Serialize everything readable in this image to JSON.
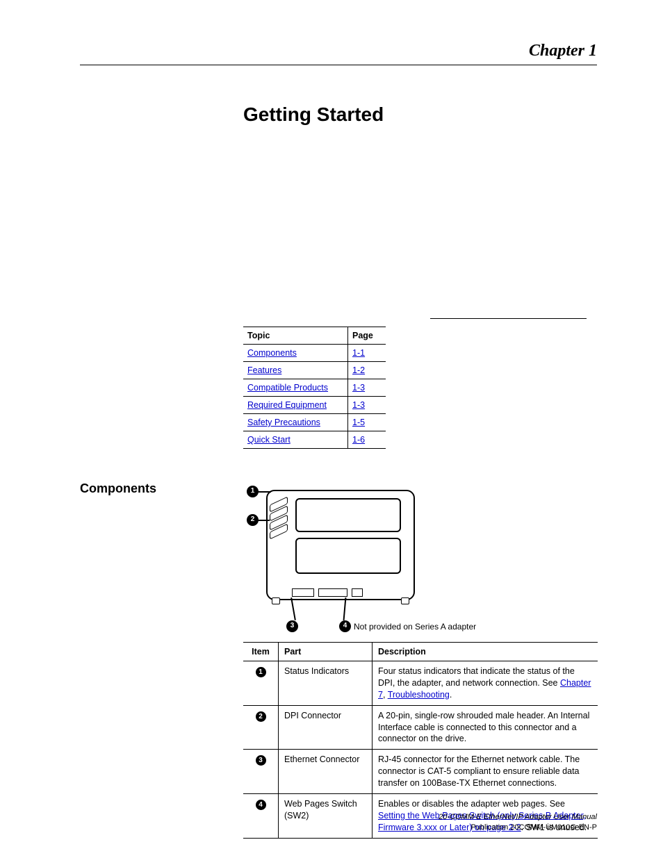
{
  "header": {
    "chapter": "Chapter 1"
  },
  "title": "Getting Started",
  "topicTable": {
    "headers": {
      "topic": "Topic",
      "page": "Page"
    },
    "rows": [
      {
        "topic": "Components",
        "page": "1-1"
      },
      {
        "topic": "Features",
        "page": "1-2"
      },
      {
        "topic": "Compatible Products",
        "page": "1-3"
      },
      {
        "topic": "Required Equipment",
        "page": "1-3"
      },
      {
        "topic": "Safety Precautions",
        "page": "1-5"
      },
      {
        "topic": "Quick Start",
        "page": "1-6"
      }
    ]
  },
  "sectionLabel": "Components",
  "diagram": {
    "callouts": {
      "c1": "1",
      "c2": "2",
      "c3": "3",
      "c4": "4"
    },
    "note": "Not provided on Series A adapter"
  },
  "partsTable": {
    "headers": {
      "item": "Item",
      "part": "Part",
      "description": "Description"
    },
    "rows": [
      {
        "num": "1",
        "part": "Status Indicators",
        "descPre": "Four status indicators that indicate the status of the DPI, the adapter, and network connection. See ",
        "link1": "Chapter 7",
        "mid": ", ",
        "link2": "Troubleshooting",
        "descPost": "."
      },
      {
        "num": "2",
        "part": "DPI Connector",
        "desc": "A 20-pin, single-row shrouded male header. An Internal Interface cable is connected to this connector and a connector on the drive."
      },
      {
        "num": "3",
        "part": "Ethernet Connector",
        "desc": "RJ-45 connector for the Ethernet network cable. The connector is CAT-5 compliant to ensure reliable data transfer on 100Base-TX Ethernet connections."
      },
      {
        "num": "4",
        "part": "Web Pages Switch (SW2)",
        "descPre": "Enables or disables the adapter web pages. See ",
        "link1": "Setting the Web Pages Switch (only Series B Adapter, Firmware 3.xxx or Later) on page 2-2",
        "descPost": ". SW1 is unused."
      }
    ]
  },
  "footer": {
    "line1": "20-COMM-E EtherNet/IP Adapter User Manual",
    "line2": "Publication 20COMM-UM010G-EN-P"
  }
}
